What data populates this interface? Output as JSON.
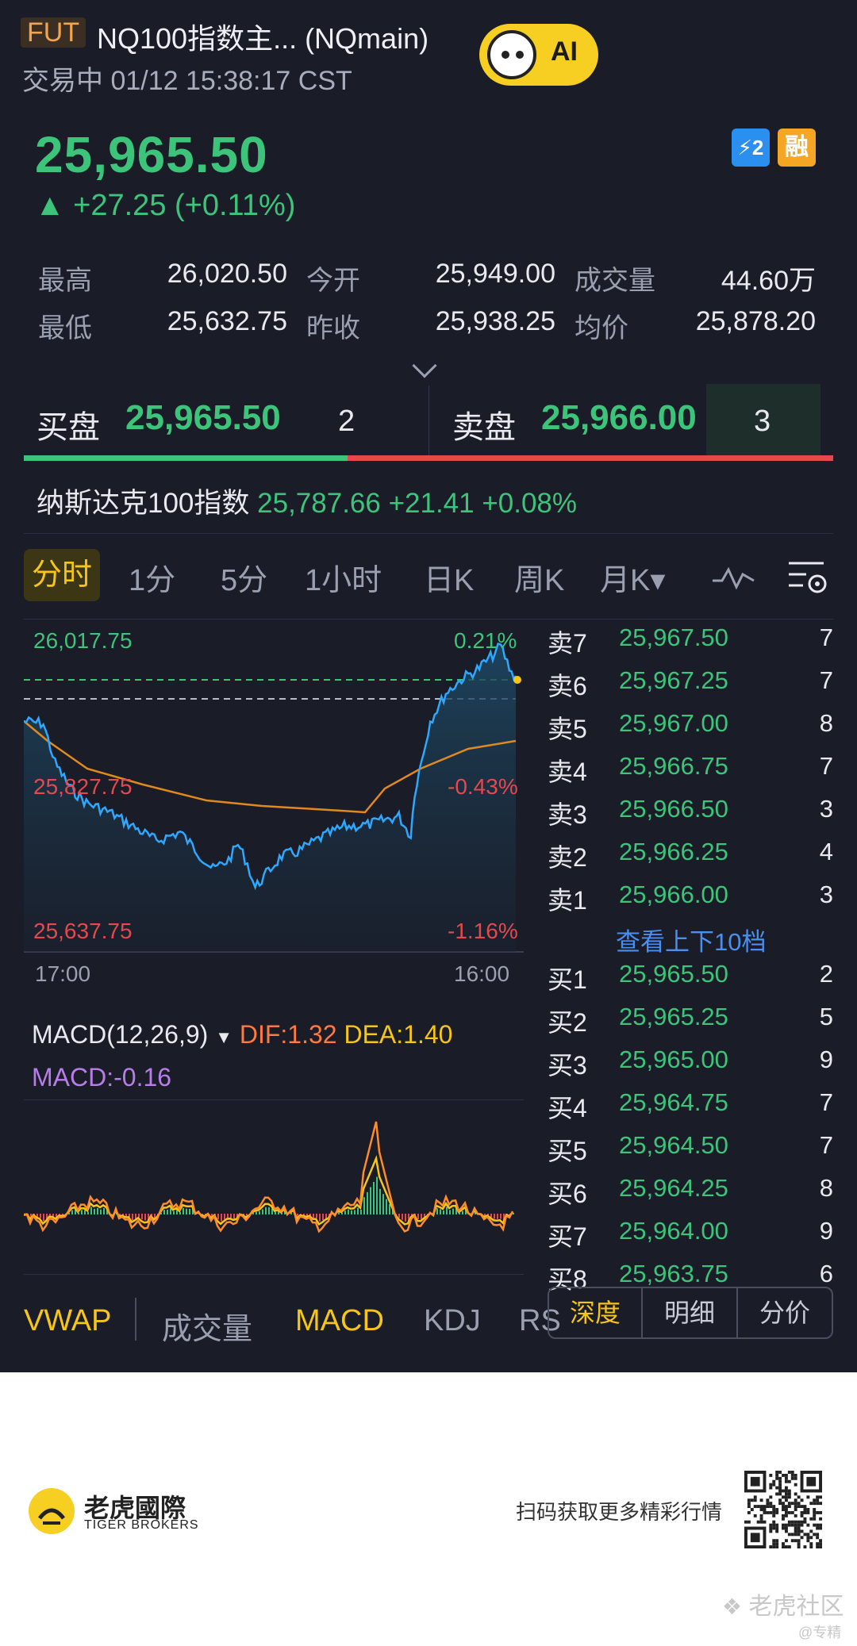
{
  "header": {
    "badge": "FUT",
    "title": "NQ100指数主... (NQmain)",
    "status": "交易中 01/12 15:38:17 CST",
    "ai_label": "AI",
    "badge_a": "⚡2",
    "badge_b": "融"
  },
  "quote": {
    "last": "25,965.50",
    "change": "▲ +27.25 (+0.11%)"
  },
  "stats": [
    {
      "label": "最高",
      "value": "26,020.50"
    },
    {
      "label": "今开",
      "value": "25,949.00"
    },
    {
      "label": "成交量",
      "value": "44.60万"
    },
    {
      "label": "最低",
      "value": "25,632.75"
    },
    {
      "label": "昨收",
      "value": "25,938.25"
    },
    {
      "label": "均价",
      "value": "25,878.20"
    }
  ],
  "bidask": {
    "bid_label": "买盘",
    "bid_price": "25,965.50",
    "bid_qty": "2",
    "ask_label": "卖盘",
    "ask_price": "25,966.00",
    "ask_qty": "3"
  },
  "index_line": {
    "name": "纳斯达克100指数",
    "value": "25,787.66 +21.41 +0.08%"
  },
  "tabs": [
    "分时",
    "1分",
    "5分",
    "1小时",
    "日K",
    "周K",
    "月K▾"
  ],
  "chart": {
    "high_label": "26,017.75",
    "high_pct": "0.21%",
    "mid_label": "25,827.75",
    "mid_pct": "-0.43%",
    "low_label": "25,637.75",
    "low_pct": "-1.16%",
    "time_start": "17:00",
    "time_end": "16:00",
    "colors": {
      "price": "#2ea8ff",
      "avg": "#e08a1e"
    }
  },
  "orderbook": {
    "asks": [
      {
        "side": "卖7",
        "price": "25,967.50",
        "qty": "7"
      },
      {
        "side": "卖6",
        "price": "25,967.25",
        "qty": "7"
      },
      {
        "side": "卖5",
        "price": "25,967.00",
        "qty": "8"
      },
      {
        "side": "卖4",
        "price": "25,966.75",
        "qty": "7"
      },
      {
        "side": "卖3",
        "price": "25,966.50",
        "qty": "3"
      },
      {
        "side": "卖2",
        "price": "25,966.25",
        "qty": "4"
      },
      {
        "side": "卖1",
        "price": "25,966.00",
        "qty": "3"
      }
    ],
    "more_label": "查看上下10档",
    "bids": [
      {
        "side": "买1",
        "price": "25,965.50",
        "qty": "2"
      },
      {
        "side": "买2",
        "price": "25,965.25",
        "qty": "5"
      },
      {
        "side": "买3",
        "price": "25,965.00",
        "qty": "9"
      },
      {
        "side": "买4",
        "price": "25,964.75",
        "qty": "7"
      },
      {
        "side": "买5",
        "price": "25,964.50",
        "qty": "7"
      },
      {
        "side": "买6",
        "price": "25,964.25",
        "qty": "8"
      },
      {
        "side": "买7",
        "price": "25,964.00",
        "qty": "9"
      },
      {
        "side": "买8",
        "price": "25,963.75",
        "qty": "6"
      }
    ]
  },
  "macd": {
    "name": "MACD(12,26,9)",
    "dif": "DIF:1.32",
    "dea": "DEA:1.40",
    "macd": "MACD:-0.16"
  },
  "bottom_tabs": [
    "VWAP",
    "成交量",
    "MACD",
    "KDJ",
    "RS"
  ],
  "segments": [
    "深度",
    "明细",
    "分价"
  ],
  "footer": {
    "brand": "老虎國際",
    "brand_sub": "TIGER BROKERS",
    "scan_text": "扫码获取更多精彩行情",
    "watermark": "老虎社区",
    "watermark_sub": "@专精"
  }
}
